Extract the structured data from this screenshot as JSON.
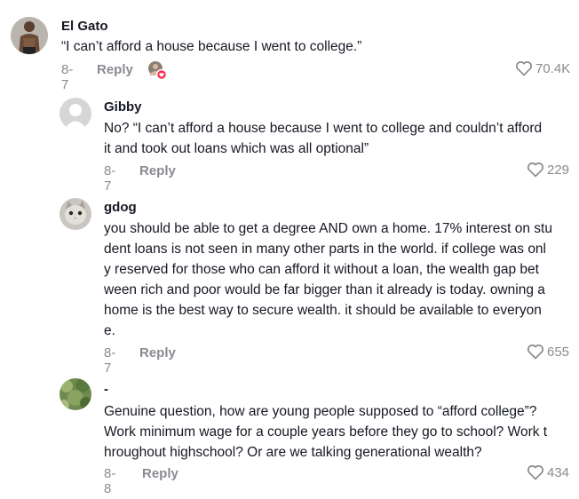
{
  "comments": [
    {
      "username": "El Gato",
      "lines": [
        "“I can’t afford a house because I went to college.”"
      ],
      "date": "8-7",
      "reply_label": "Reply",
      "likes": "70.4K",
      "avatar": "person-photo"
    },
    {
      "username": "Gibby",
      "lines": [
        "No? “I can’t afford a house because I went to college and couldn’t afford",
        "it and took out loans which was all optional”"
      ],
      "date": "8-7",
      "reply_label": "Reply",
      "likes": "229",
      "avatar": "default-user-icon"
    },
    {
      "username": "gdog",
      "lines": [
        "you should be able to get a degree AND own a home. 17% interest on stu",
        "dent loans is not seen in many other parts in the world. if college was onl",
        "y reserved for those who can afford it without a loan, the wealth gap bet",
        "ween rich and poor would be far bigger than it already is today. owning a",
        "home is the best way to secure wealth. it should be available to everyon",
        "e."
      ],
      "date": "8-7",
      "reply_label": "Reply",
      "likes": "655",
      "avatar": "cat-photo"
    },
    {
      "username": "-",
      "lines": [
        "Genuine question, how are young people supposed to “afford college”?",
        "Work minimum wage for a couple years before they go to school? Work t",
        "hroughout highschool? Or are we talking generational wealth?"
      ],
      "date": "8-8",
      "reply_label": "Reply",
      "likes": "434",
      "avatar": "nature-photo"
    }
  ],
  "colors": {
    "text": "#161823",
    "muted": "#8a8b91",
    "badge": "#fe2c55"
  }
}
